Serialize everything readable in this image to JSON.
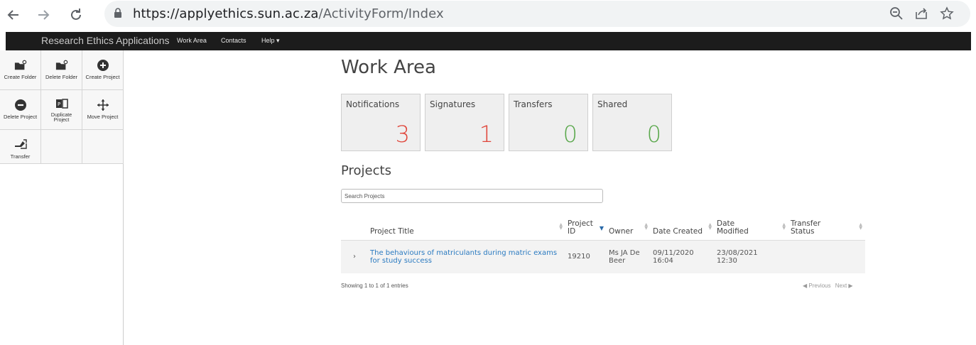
{
  "browser": {
    "url_host": "https://applyethics.sun.ac.za",
    "url_path": "/ActivityForm/Index",
    "back_icon": "back-arrow-icon",
    "forward_icon": "forward-arrow-icon",
    "reload_icon": "reload-icon"
  },
  "navbar": {
    "brand": "Research Ethics Applications",
    "items": [
      {
        "label": "Work Area"
      },
      {
        "label": "Contacts"
      },
      {
        "label": "Help ▾"
      }
    ]
  },
  "toolbar": {
    "items": [
      {
        "label": "Create Folder",
        "icon": "create-folder-icon"
      },
      {
        "label": "Delete Folder",
        "icon": "delete-folder-icon"
      },
      {
        "label": "Create Project",
        "icon": "plus-circle-icon"
      },
      {
        "label": "Delete Project",
        "icon": "minus-circle-icon"
      },
      {
        "label": "Duplicate Project",
        "icon": "duplicate-icon"
      },
      {
        "label": "Move Project",
        "icon": "move-icon"
      },
      {
        "label": "Transfer",
        "icon": "transfer-icon"
      }
    ]
  },
  "main": {
    "title": "Work Area",
    "tiles": [
      {
        "label": "Notifications",
        "value": "3",
        "color": "#e0453a"
      },
      {
        "label": "Signatures",
        "value": "1",
        "color": "#e0453a"
      },
      {
        "label": "Transfers",
        "value": "0",
        "color": "#5aa84c"
      },
      {
        "label": "Shared",
        "value": "0",
        "color": "#5aa84c"
      }
    ],
    "projects_heading": "Projects",
    "search_placeholder": "Search Projects",
    "table": {
      "headers": {
        "title": "Project Title",
        "id_line1": "Project",
        "id_line2": "ID",
        "owner": "Owner",
        "created": "Date Created",
        "modified_line1": "Date",
        "modified_line2": "Modified",
        "status_line1": "Transfer",
        "status_line2": "Status"
      },
      "rows": [
        {
          "expand": "›",
          "title": "The behaviours of matriculants during matric exams for study success",
          "id": "19210",
          "owner_line1": "Ms JA De",
          "owner_line2": "Beer",
          "created_line1": "09/11/2020",
          "created_line2": "16:04",
          "modified_line1": "23/08/2021",
          "modified_line2": "12:30",
          "status": ""
        }
      ]
    },
    "info": "Showing 1 to 1 of 1 entries",
    "pager": {
      "previous": "◀ Previous",
      "next": "Next ▶"
    }
  }
}
